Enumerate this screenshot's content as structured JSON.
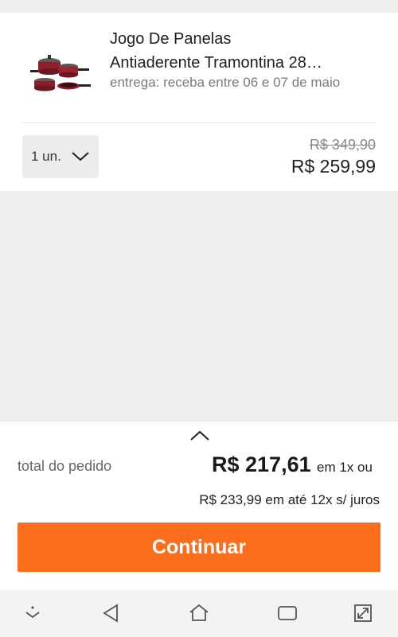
{
  "product": {
    "title_line1": "Jogo De Panelas",
    "title_line2": "Antiaderente Tramontina 28…",
    "delivery": "entrega: receba entre 06 e 07 de maio",
    "quantity": "1 un.",
    "old_price": "R$ 349,90",
    "price": "R$ 259,99",
    "image_icon": "cookware-set-image"
  },
  "summary": {
    "total_label": "total do pedido",
    "total_value": "R$ 217,61",
    "total_suffix": "em 1x ou",
    "installments": "R$ 233,99 em até 12x s/ juros",
    "expand_icon": "chevron-up-icon"
  },
  "actions": {
    "continue_label": "Continuar"
  },
  "colors": {
    "accent": "#fa6e1d",
    "background": "#efefef"
  },
  "navbar": {
    "icons": [
      "chevron-down-dot-icon",
      "back-icon",
      "home-icon",
      "recents-icon",
      "expand-icon"
    ]
  }
}
